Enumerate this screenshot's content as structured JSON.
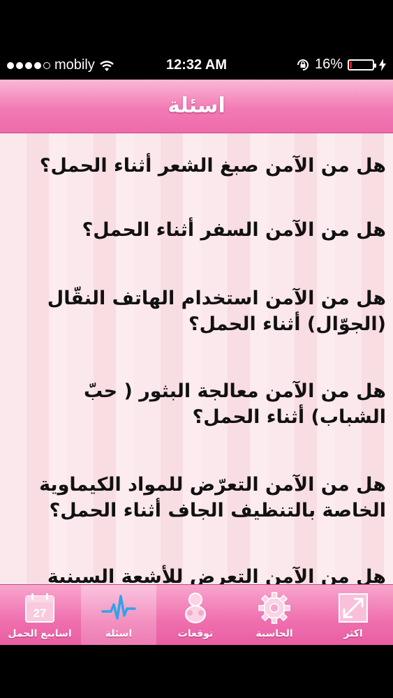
{
  "status_bar": {
    "carrier": "mobily",
    "time": "12:32 AM",
    "battery_percent": "16%",
    "battery_level": 0.16,
    "signal_bars": 4,
    "signal_total": 5,
    "battery_color": "#e3161b"
  },
  "nav": {
    "title": "اسئلة"
  },
  "questions": [
    "هل من الآمن صبغ الشعر أثناء الحمل؟",
    "هل من الآمن السفر أثناء الحمل؟",
    "هل من الآمن استخدام الهاتف النقّال (الجوّال) أثناء الحمل؟",
    "هل من الآمن معالجة البثور ( حبّ الشباب) أثناء الحمل؟",
    "هل من الآمن التعرّض للمواد الكيماوية الخاصة بالتنظيف الجاف أثناء الحمل؟",
    "هل من الآمن التعرض للأشعة السينية أثناء"
  ],
  "tab_bar": {
    "tabs": [
      {
        "label": "اسابيع الحمل",
        "icon": "calendar-icon",
        "calendar_day": "27",
        "selected": false
      },
      {
        "label": "اسئلة",
        "icon": "heartbeat-icon",
        "selected": true
      },
      {
        "label": "توقعات",
        "icon": "baby-icon",
        "selected": false
      },
      {
        "label": "الحاسبة",
        "icon": "gear-icon",
        "selected": false
      },
      {
        "label": "اكثر",
        "icon": "expand-arrows-icon",
        "selected": false
      }
    ]
  },
  "colors": {
    "accent_pink": "#ef6fae",
    "content_background": "#fbe8ec",
    "text": "#111111"
  }
}
